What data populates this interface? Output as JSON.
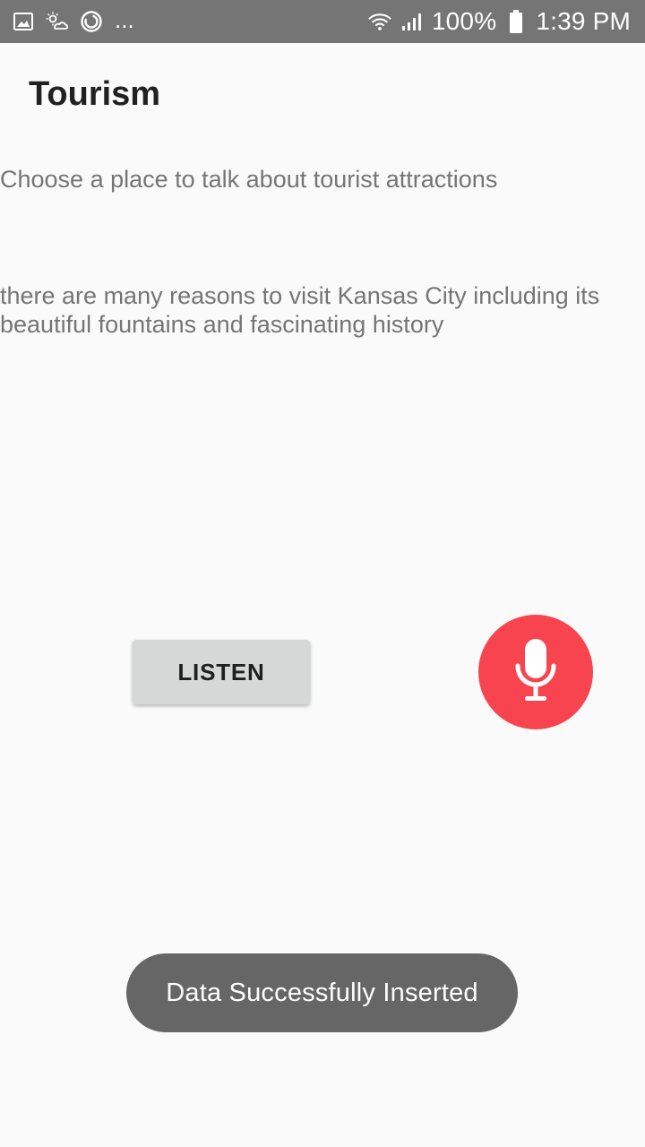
{
  "status_bar": {
    "icons_left": [
      "image-icon",
      "weather-icon",
      "sync-icon"
    ],
    "more_text": "...",
    "battery": "100%",
    "time": "1:39 PM"
  },
  "app": {
    "title": "Tourism"
  },
  "prompt": {
    "text": "Choose a place to talk about tourist attractions"
  },
  "result": {
    "text": "there are many reasons to visit Kansas City including its beautiful fountains and fascinating history"
  },
  "controls": {
    "listen_label": "LISTEN",
    "mic_icon": "microphone-icon",
    "mic_color": "#f7444e"
  },
  "toast": {
    "message": "Data Successfully Inserted"
  }
}
